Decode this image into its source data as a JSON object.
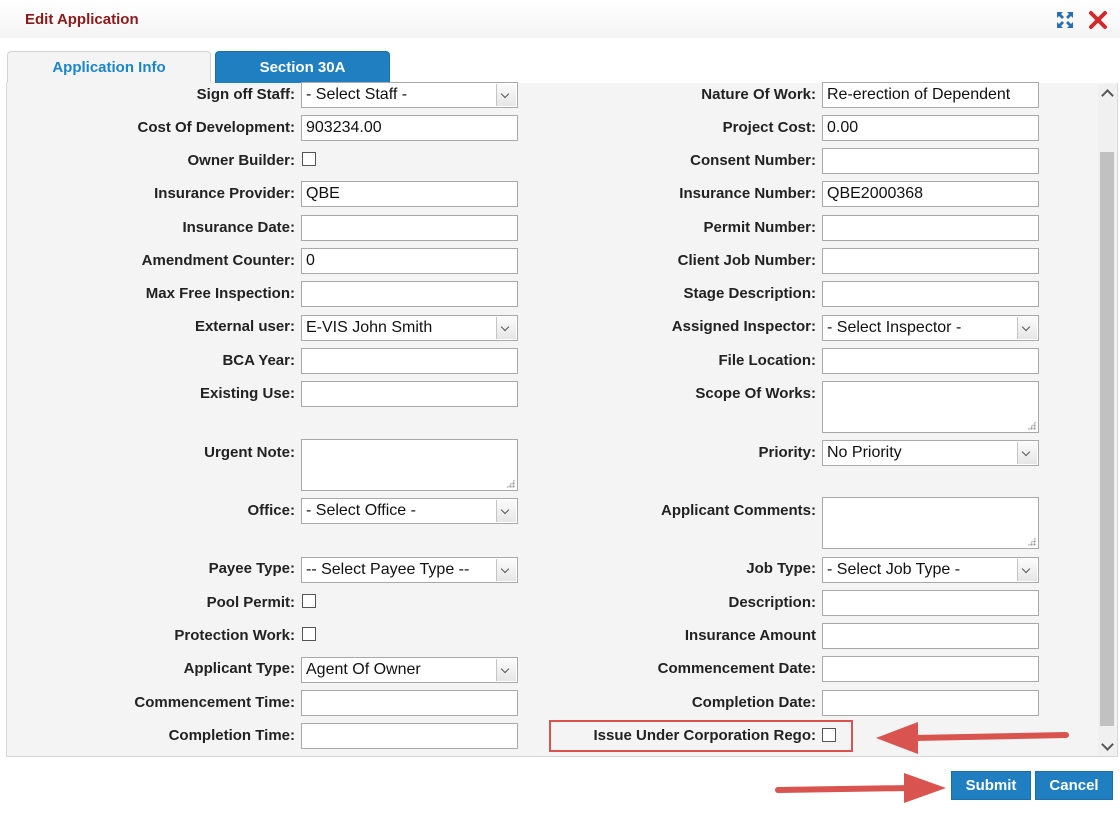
{
  "dialog": {
    "title": "Edit Application"
  },
  "icons": {
    "maximize": "maximize-icon",
    "close": "close-icon"
  },
  "colors": {
    "title": "#8b1a1a",
    "accent": "#1f7fc0",
    "highlight": "#d9534f"
  },
  "tabs": [
    {
      "label": "Application Info",
      "active": true
    },
    {
      "label": "Section 30A",
      "active": false
    }
  ],
  "left": {
    "sign_off_staff": {
      "label": "Sign off Staff:",
      "value": "- Select Staff -"
    },
    "cost_of_development": {
      "label": "Cost Of Development:",
      "value": "903234.00"
    },
    "owner_builder": {
      "label": "Owner Builder:",
      "checked": false
    },
    "insurance_provider": {
      "label": "Insurance Provider:",
      "value": "QBE"
    },
    "insurance_date": {
      "label": "Insurance Date:",
      "value": ""
    },
    "amendment_counter": {
      "label": "Amendment Counter:",
      "value": "0"
    },
    "max_free_inspection": {
      "label": "Max Free Inspection:",
      "value": ""
    },
    "external_user": {
      "label": "External user:",
      "value": "E-VIS John Smith"
    },
    "bca_year": {
      "label": "BCA Year:",
      "value": ""
    },
    "existing_use": {
      "label": "Existing Use:",
      "value": ""
    },
    "urgent_note": {
      "label": "Urgent Note:",
      "value": ""
    },
    "office": {
      "label": "Office:",
      "value": "- Select Office -"
    },
    "payee_type": {
      "label": "Payee Type:",
      "value": "-- Select Payee Type --"
    },
    "pool_permit": {
      "label": "Pool Permit:",
      "checked": false
    },
    "protection_work": {
      "label": "Protection Work:",
      "checked": false
    },
    "applicant_type": {
      "label": "Applicant Type:",
      "value": "Agent Of Owner"
    },
    "commencement_time": {
      "label": "Commencement Time:",
      "value": ""
    },
    "completion_time": {
      "label": "Completion Time:",
      "value": ""
    }
  },
  "right": {
    "nature_of_work": {
      "label": "Nature Of Work:",
      "value": "Re-erection of Dependent"
    },
    "project_cost": {
      "label": "Project Cost:",
      "value": "0.00"
    },
    "consent_number": {
      "label": "Consent Number:",
      "value": ""
    },
    "insurance_number": {
      "label": "Insurance Number:",
      "value": "QBE2000368"
    },
    "permit_number": {
      "label": "Permit Number:",
      "value": ""
    },
    "client_job_number": {
      "label": "Client Job Number:",
      "value": ""
    },
    "stage_description": {
      "label": "Stage Description:",
      "value": ""
    },
    "assigned_inspector": {
      "label": "Assigned Inspector:",
      "value": "- Select Inspector -"
    },
    "file_location": {
      "label": "File Location:",
      "value": ""
    },
    "scope_of_works": {
      "label": "Scope Of Works:",
      "value": ""
    },
    "priority": {
      "label": "Priority:",
      "value": "No Priority"
    },
    "applicant_comments": {
      "label": "Applicant Comments:",
      "value": ""
    },
    "job_type": {
      "label": "Job Type:",
      "value": "- Select Job Type -"
    },
    "description": {
      "label": "Description:",
      "value": ""
    },
    "insurance_amount": {
      "label": "Insurance Amount",
      "value": ""
    },
    "commencement_date": {
      "label": "Commencement Date:",
      "value": ""
    },
    "completion_date": {
      "label": "Completion Date:",
      "value": ""
    },
    "issue_under_corporation_rego": {
      "label": "Issue Under Corporation Rego:",
      "checked": false
    }
  },
  "buttons": {
    "submit": "Submit",
    "cancel": "Cancel"
  }
}
